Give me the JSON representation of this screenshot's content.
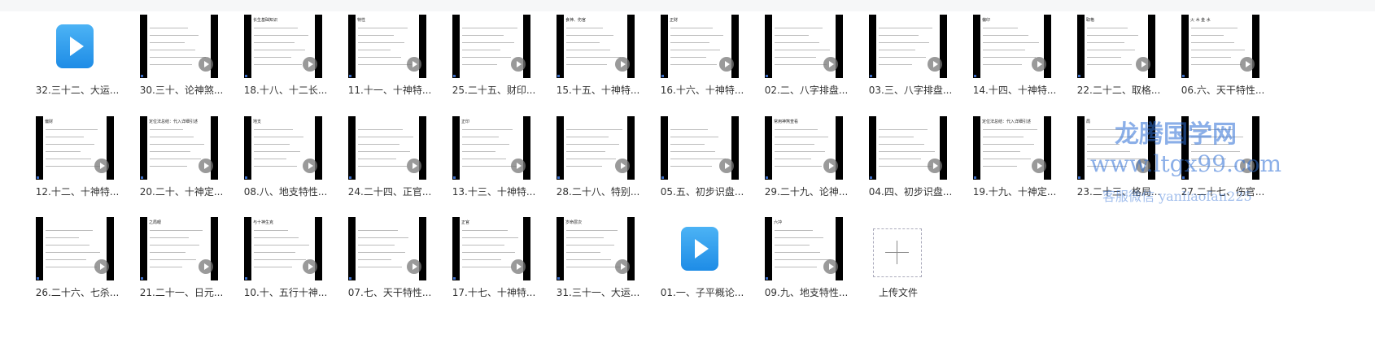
{
  "files": [
    {
      "label": "32.三十二、大运...",
      "kind": "video-icon"
    },
    {
      "label": "30.三十、论神煞...",
      "kind": "thumb",
      "hdr": ""
    },
    {
      "label": "18.十八、十二长...",
      "kind": "thumb",
      "hdr": "长生基础知识"
    },
    {
      "label": "11.十一、十神特...",
      "kind": "thumb",
      "hdr": "特性"
    },
    {
      "label": "25.二十五、财印...",
      "kind": "thumb",
      "hdr": ""
    },
    {
      "label": "15.十五、十神特...",
      "kind": "thumb",
      "hdr": "食神、伤官"
    },
    {
      "label": "16.十六、十神特...",
      "kind": "thumb",
      "hdr": "正财"
    },
    {
      "label": "02.二、八字排盘...",
      "kind": "thumb",
      "hdr": ""
    },
    {
      "label": "03.三、八字排盘...",
      "kind": "thumb",
      "hdr": ""
    },
    {
      "label": "14.十四、十神特...",
      "kind": "thumb",
      "hdr": "偏印"
    },
    {
      "label": "22.二十二、取格...",
      "kind": "thumb",
      "hdr": "取格"
    },
    {
      "label": "06.六、天干特性...",
      "kind": "thumb",
      "hdr": "火 木 金 水"
    },
    {
      "label": "12.十二、十神特...",
      "kind": "thumb",
      "hdr": "偏财"
    },
    {
      "label": "20.二十、十神定...",
      "kind": "thumb",
      "hdr": "定位法总结：代入详细引述"
    },
    {
      "label": "08.八、地支特性...",
      "kind": "thumb",
      "hdr": "地支"
    },
    {
      "label": "24.二十四、正官...",
      "kind": "thumb",
      "hdr": ""
    },
    {
      "label": "13.十三、十神特...",
      "kind": "thumb",
      "hdr": "正印"
    },
    {
      "label": "28.二十八、特别...",
      "kind": "thumb",
      "hdr": ""
    },
    {
      "label": "05.五、初步识盘...",
      "kind": "thumb",
      "hdr": ""
    },
    {
      "label": "29.二十九、论神...",
      "kind": "thumb",
      "hdr": "常用神煞查看"
    },
    {
      "label": "04.四、初步识盘...",
      "kind": "thumb",
      "hdr": ""
    },
    {
      "label": "19.十九、十神定...",
      "kind": "thumb",
      "hdr": "定位法总结：代入详细引述"
    },
    {
      "label": "23.二十三、格局...",
      "kind": "thumb",
      "hdr": "局"
    },
    {
      "label": "27.二十七、伤官...",
      "kind": "thumb",
      "hdr": ""
    },
    {
      "label": "26.二十六、七杀...",
      "kind": "thumb",
      "hdr": ""
    },
    {
      "label": "21.二十一、日元...",
      "kind": "thumb",
      "hdr": "之局眼"
    },
    {
      "label": "10.十、五行十神...",
      "kind": "thumb",
      "hdr": "与十神生克"
    },
    {
      "label": "07.七、天干特性...",
      "kind": "thumb",
      "hdr": ""
    },
    {
      "label": "17.十七、十神特...",
      "kind": "thumb",
      "hdr": "正官"
    },
    {
      "label": "31.三十一、大运...",
      "kind": "thumb",
      "hdr": "岁命层次"
    },
    {
      "label": "01.一、子平概论...",
      "kind": "video-icon"
    },
    {
      "label": "09.九、地支特性...",
      "kind": "thumb",
      "hdr": "六冲"
    }
  ],
  "upload": {
    "label": "上传文件"
  },
  "watermark": {
    "line1": "龙腾国学网",
    "line2": "www.ltgx99.com",
    "line3": "客服微信 yanliaofan225"
  }
}
